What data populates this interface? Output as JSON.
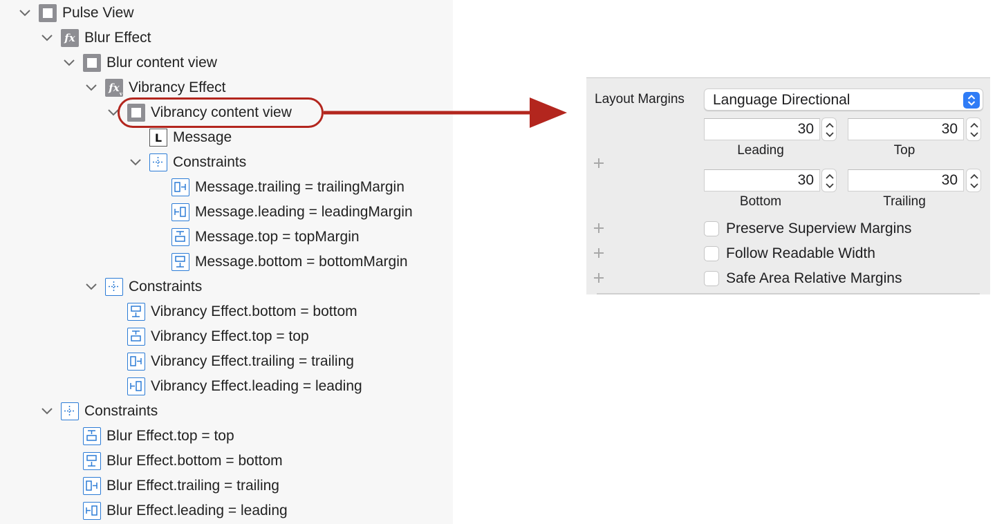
{
  "tree": {
    "items": [
      {
        "label": "Pulse View"
      },
      {
        "label": "Blur Effect"
      },
      {
        "label": "Blur content view"
      },
      {
        "label": "Vibrancy Effect"
      },
      {
        "label": "Vibrancy content view"
      },
      {
        "label": "Message"
      },
      {
        "label": "Constraints"
      },
      {
        "label": "Message.trailing = trailingMargin"
      },
      {
        "label": "Message.leading = leadingMargin"
      },
      {
        "label": "Message.top = topMargin"
      },
      {
        "label": "Message.bottom = bottomMargin"
      },
      {
        "label": "Constraints"
      },
      {
        "label": "Vibrancy Effect.bottom = bottom"
      },
      {
        "label": "Vibrancy Effect.top = top"
      },
      {
        "label": "Vibrancy Effect.trailing = trailing"
      },
      {
        "label": "Vibrancy Effect.leading = leading"
      },
      {
        "label": "Constraints"
      },
      {
        "label": "Blur Effect.top = top"
      },
      {
        "label": "Blur Effect.bottom = bottom"
      },
      {
        "label": "Blur Effect.trailing = trailing"
      },
      {
        "label": "Blur Effect.leading = leading"
      }
    ],
    "fx_icon_text": "fx",
    "label_icon_text": "L"
  },
  "inspector": {
    "layout_margins_label": "Layout Margins",
    "layout_margins_value": "Language Directional",
    "fields": {
      "leading": {
        "value": "30",
        "caption": "Leading"
      },
      "top": {
        "value": "30",
        "caption": "Top"
      },
      "bottom": {
        "value": "30",
        "caption": "Bottom"
      },
      "trailing": {
        "value": "30",
        "caption": "Trailing"
      }
    },
    "checkboxes": [
      {
        "label": "Preserve Superview Margins",
        "checked": false
      },
      {
        "label": "Follow Readable Width",
        "checked": false
      },
      {
        "label": "Safe Area Relative Margins",
        "checked": false
      }
    ]
  },
  "colors": {
    "accent": "#2f7cf6",
    "callout": "#b3261e",
    "constraint_icon": "#2b7bd6",
    "view_icon": "#8e8e93"
  }
}
